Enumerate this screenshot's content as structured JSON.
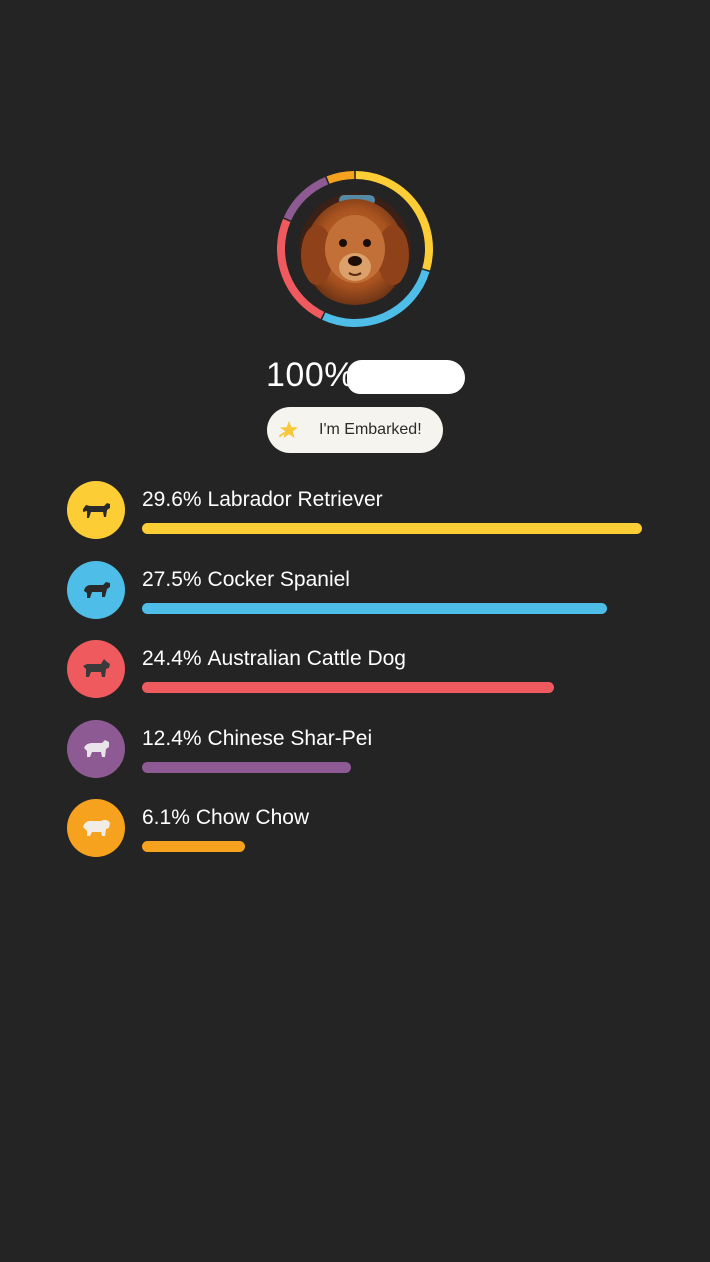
{
  "colors": {
    "background": "#252424",
    "labrador": "#fccd34",
    "cocker": "#4ebde8",
    "cattle": "#ef5a5f",
    "sharpei": "#8e5a93",
    "chow": "#f6a21f",
    "badge_bg": "#f6f4ee"
  },
  "profile": {
    "percent_text": "100%",
    "avatar_icon": "dog-photo"
  },
  "badge": {
    "icon": "star-icon",
    "label": "I'm Embarked!"
  },
  "breeds": [
    {
      "percent": "29.6%",
      "name": "Labrador Retriever",
      "value": 29.6,
      "color": "#fccd34",
      "icon": "labrador-dog-icon"
    },
    {
      "percent": "27.5%",
      "name": "Cocker Spaniel",
      "value": 27.5,
      "color": "#4ebde8",
      "icon": "cocker-spaniel-dog-icon"
    },
    {
      "percent": "24.4%",
      "name": "Australian Cattle Dog",
      "value": 24.4,
      "color": "#ef5a5f",
      "icon": "cattle-dog-icon"
    },
    {
      "percent": "12.4%",
      "name": "Chinese Shar-Pei",
      "value": 12.4,
      "color": "#8e5a93",
      "icon": "shar-pei-dog-icon"
    },
    {
      "percent": "6.1%",
      "name": "Chow Chow",
      "value": 6.1,
      "color": "#f6a21f",
      "icon": "chow-chow-dog-icon"
    }
  ]
}
